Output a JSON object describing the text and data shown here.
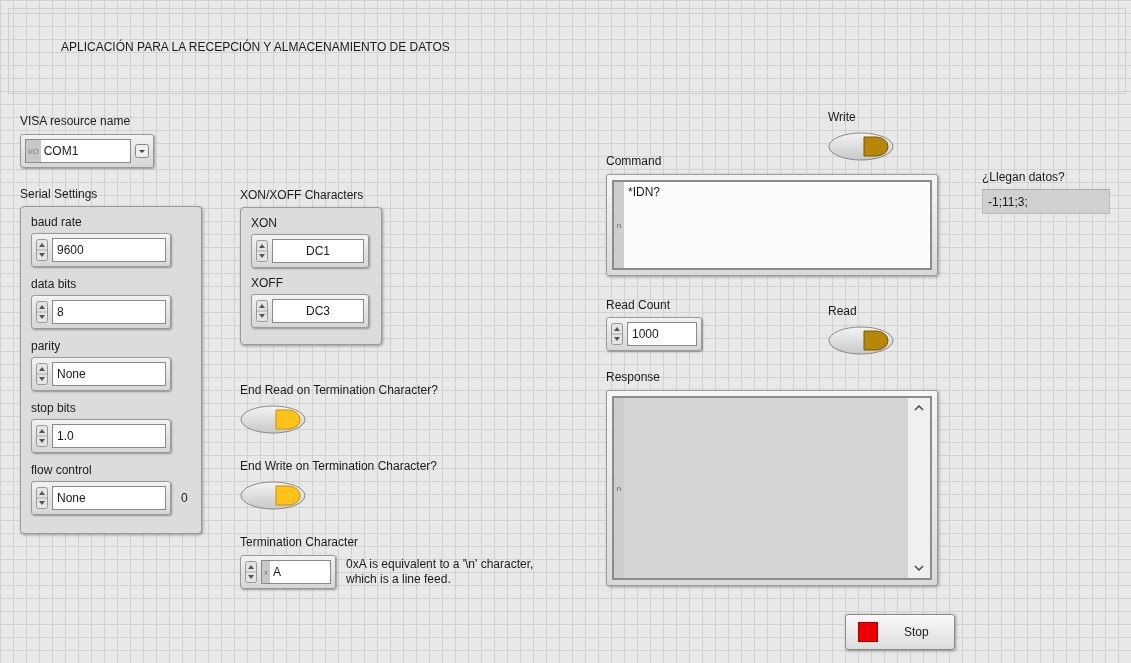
{
  "title": "APLICACIÓN PARA LA RECEPCIÓN Y ALMACENAMIENTO DE DATOS",
  "visa": {
    "label": "VISA resource name",
    "io_prefix": "I/O",
    "value": "COM1"
  },
  "serial_settings": {
    "label": "Serial Settings",
    "fields": [
      {
        "label": "baud rate",
        "value": "9600"
      },
      {
        "label": "data bits",
        "value": "8"
      },
      {
        "label": "parity",
        "value": "None"
      },
      {
        "label": "stop bits",
        "value": "1.0"
      },
      {
        "label": "flow control",
        "value": "None",
        "indicator": "0"
      }
    ]
  },
  "xon_xoff": {
    "label": "XON/XOFF Characters",
    "fields": [
      {
        "label": "XON",
        "value": "DC1"
      },
      {
        "label": "XOFF",
        "value": "DC3"
      }
    ]
  },
  "switches": [
    {
      "label": "End Read on Termination Character?",
      "on": true
    },
    {
      "label": "End Write on Termination Character?",
      "on": true
    },
    {
      "label": "Write",
      "on": false
    },
    {
      "label": "Read",
      "on": false
    }
  ],
  "termination": {
    "label": "Termination Character",
    "radix": "x",
    "value": "A",
    "note": "0xA is equivalent to a '\\n' character, which is a line feed."
  },
  "command": {
    "label": "Command",
    "display_mode": "n",
    "value": "*IDN?"
  },
  "llegan": {
    "label": "¿Llegan datos?",
    "value": "-1;11;3;"
  },
  "read_count": {
    "label": "Read Count",
    "value": "1000"
  },
  "response": {
    "label": "Response",
    "display_mode": "n"
  },
  "stop_button": {
    "label": "Stop"
  }
}
